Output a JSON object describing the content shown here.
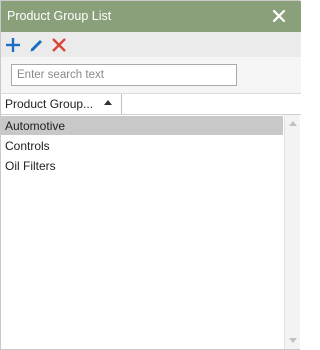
{
  "window": {
    "title": "Product Group List"
  },
  "toolbar": {
    "add_icon": "plus-icon",
    "edit_icon": "pencil-icon",
    "delete_icon": "x-icon"
  },
  "search": {
    "placeholder": "Enter search text",
    "value": ""
  },
  "grid": {
    "column_header": "Product Group...",
    "sort": "ascending",
    "rows": [
      "Automotive",
      "Controls",
      "Oil Filters"
    ],
    "selected_row": "Automotive"
  },
  "colors": {
    "titlebar": "#8aa07a",
    "add_icon": "#1a6fc4",
    "edit_icon": "#1a6fc4",
    "delete_icon": "#d9453a",
    "selected_row": "#c8c8c8"
  }
}
